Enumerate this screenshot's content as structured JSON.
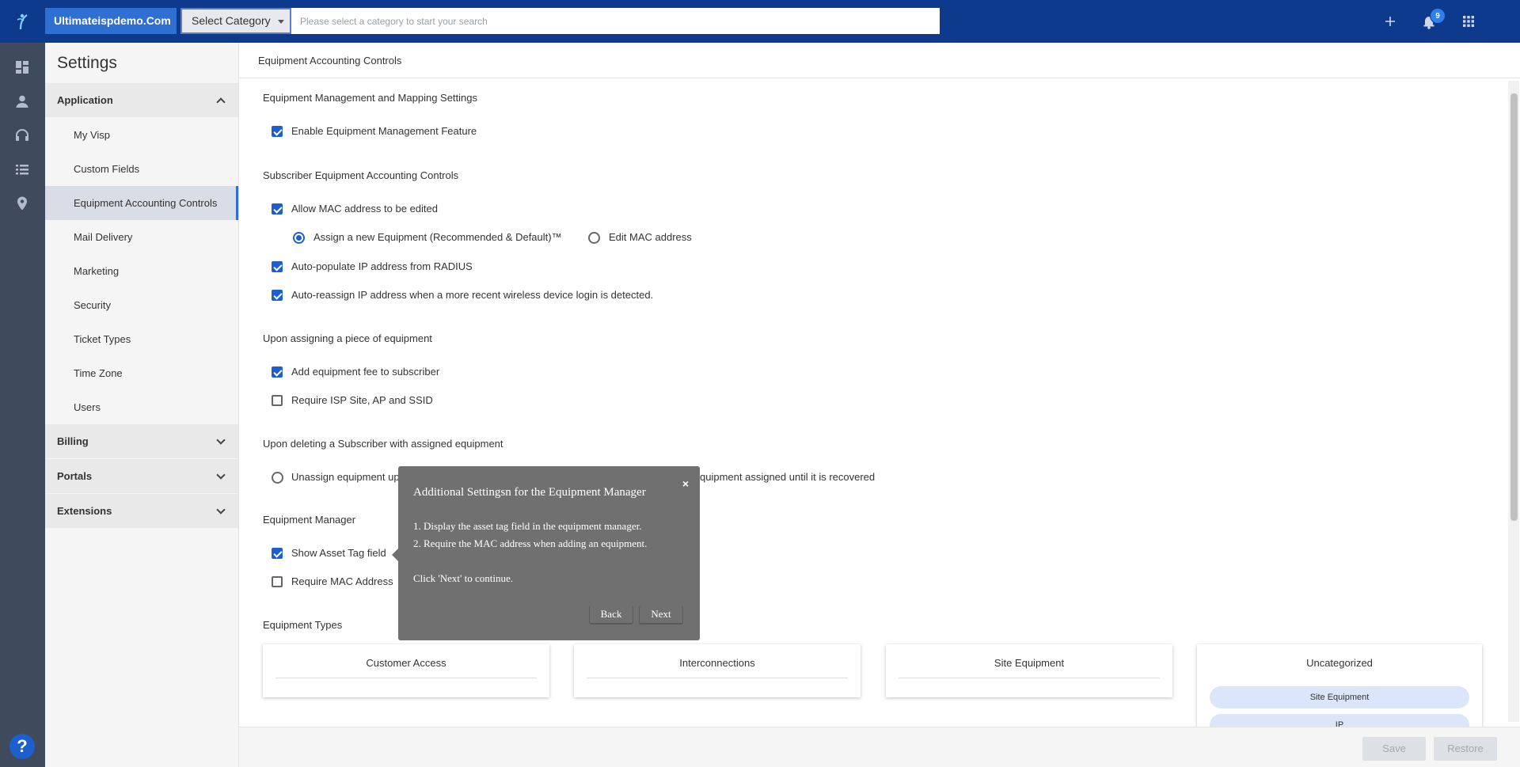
{
  "topbar": {
    "company": "Ultimateispdemo.Com",
    "category_select": "Select Category",
    "search_placeholder": "Please select a category to start your search",
    "notifications_count": "9",
    "icons": [
      "add-icon",
      "bell-icon",
      "apps-grid-icon"
    ]
  },
  "rail": {
    "icons": [
      "dashboard-icon",
      "person-icon",
      "headset-icon",
      "list-icon",
      "location-pin-icon"
    ],
    "help": "?"
  },
  "sidebar": {
    "title": "Settings",
    "sections": [
      {
        "label": "Application",
        "expanded": true
      },
      {
        "label": "Billing",
        "expanded": false
      },
      {
        "label": "Portals",
        "expanded": false
      },
      {
        "label": "Extensions",
        "expanded": false
      }
    ],
    "items": [
      {
        "label": "My Visp"
      },
      {
        "label": "Custom Fields"
      },
      {
        "label": "Equipment Accounting Controls",
        "active": true
      },
      {
        "label": "Mail Delivery"
      },
      {
        "label": "Marketing"
      },
      {
        "label": "Security"
      },
      {
        "label": "Ticket Types"
      },
      {
        "label": "Time Zone"
      },
      {
        "label": "Users"
      }
    ]
  },
  "main": {
    "header": "Equipment Accounting Controls",
    "groups": {
      "mgmt": "Equipment Management and Mapping Settings",
      "subscriber": "Subscriber Equipment Accounting Controls",
      "assigning": "Upon assigning a piece of equipment",
      "deleting": "Upon deleting a Subscriber with assigned equipment",
      "manager": "Equipment Manager",
      "types": "Equipment Types"
    },
    "options": {
      "enable_mgmt": "Enable Equipment Management Feature",
      "allow_mac_edit": "Allow MAC address to be edited",
      "assign_new": "Assign a new Equipment (Recommended & Default)™",
      "edit_mac": "Edit MAC address",
      "autopop_ip": "Auto-populate IP address from RADIUS",
      "autoreassign_ip": "Auto-reassign IP address when a more recent wireless device login is detected.",
      "add_fee": "Add equipment fee to subscriber",
      "require_site": "Require ISP Site, AP and SSID",
      "unassign_partial": "Unassign equipment up",
      "keep_partial": "quipment assigned until it is recovered",
      "show_asset_tag": "Show Asset Tag field",
      "require_mac": "Require MAC Address"
    },
    "type_cards": [
      {
        "title": "Customer Access"
      },
      {
        "title": "Interconnections"
      },
      {
        "title": "Site Equipment"
      },
      {
        "title": "Uncategorized",
        "chips": [
          "Site Equipment",
          "IP"
        ]
      }
    ],
    "footer": {
      "save": "Save",
      "restore": "Restore"
    }
  },
  "tour": {
    "title": "Additional Settingsn for the Equipment Manager",
    "close": "×",
    "line1": "1. Display the asset tag field in the equipment manager.",
    "line2": "2. Require the MAC address when adding an equipment.",
    "line3": "Click 'Next' to continue.",
    "back": "Back",
    "next": "Next"
  }
}
